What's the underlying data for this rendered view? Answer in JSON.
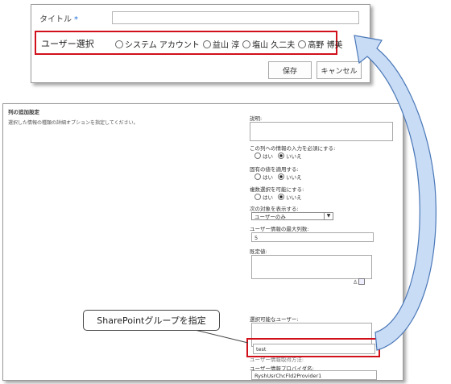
{
  "form": {
    "title_label": "タイトル",
    "required_mark": "*",
    "user_select_label": "ユーザー選択",
    "user_options": [
      "システム アカウント",
      "益山 淳",
      "塩山 久二夫",
      "高野 博美"
    ],
    "save_label": "保存",
    "cancel_label": "キャンセル"
  },
  "settings": {
    "section_title": "列の追加設定",
    "section_desc": "選択した情報の種類の詳細オプションを指定してください。",
    "description_label": "説明:",
    "require_label": "この列への情報の入力を必須にする:",
    "unique_label": "固有の値を適用する:",
    "multi_label": "複数選択を可能にする:",
    "yes_label": "はい",
    "no_label": "いいえ",
    "show_label": "次の対象を表示する:",
    "show_value": "ユーザーのみ",
    "max_label": "ユーザー情報の最大列数:",
    "max_value": "5",
    "default_label": "既定値:",
    "selectable_label": "選択可能なユーザー:",
    "group_label": "ユーザー情報取得方法:",
    "group_value": "test",
    "provider_label": "ユーザー情報プロバイダ名:",
    "provider_value": "RyshUsrChcFld2Provider1"
  },
  "callout": {
    "text": "SharePointグループを指定"
  },
  "colors": {
    "highlight": "#d0101a",
    "arrow_fill": "#c9dcf5",
    "arrow_stroke": "#4a78b8"
  }
}
